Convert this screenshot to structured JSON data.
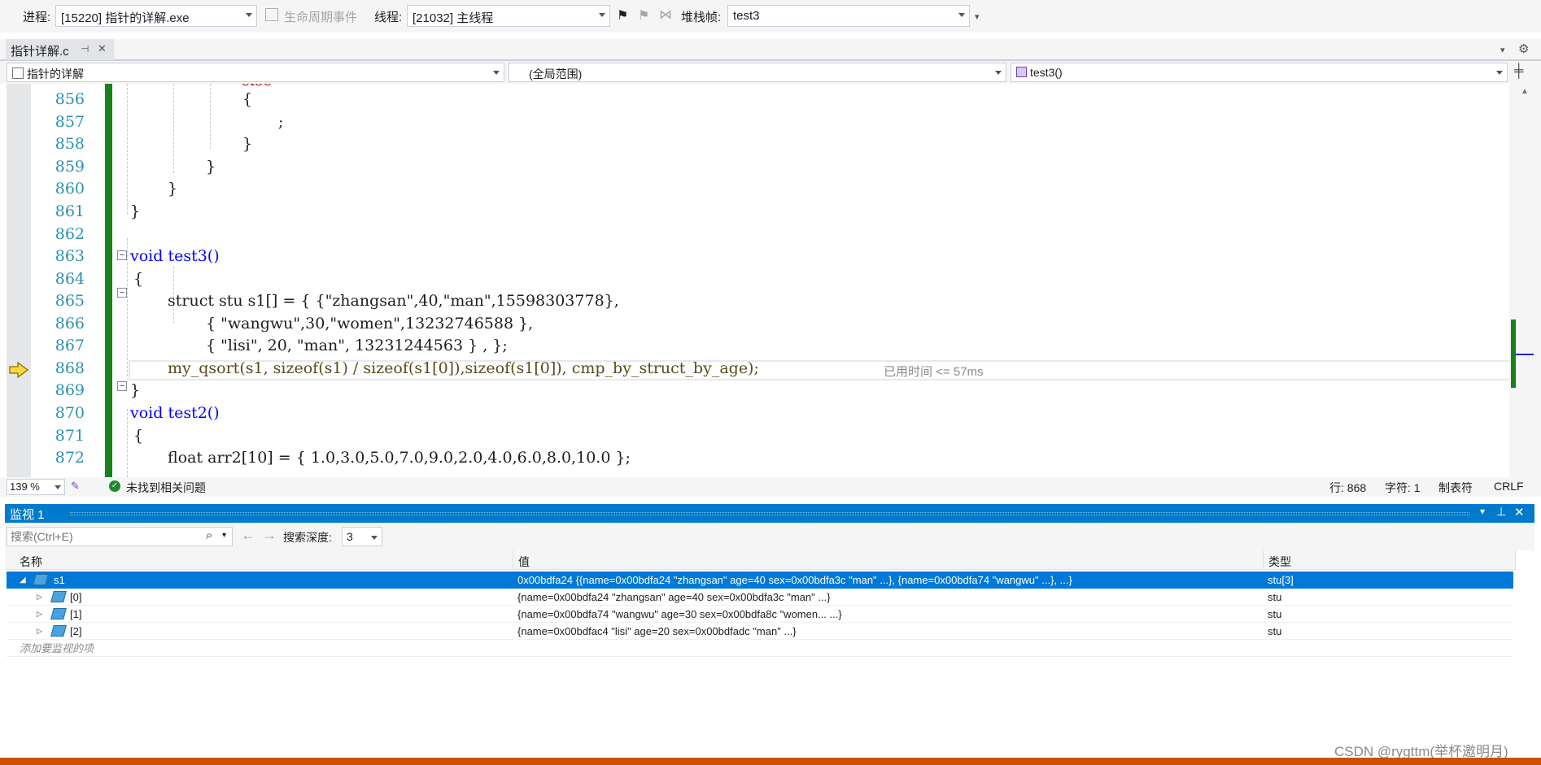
{
  "toolbar": {
    "process_label": "进程:",
    "process_value": "[15220] 指针的详解.exe",
    "lifecycle_label": "生命周期事件",
    "thread_label": "线程:",
    "thread_value": "[21032] 主线程",
    "stackframe_label": "堆栈帧:",
    "stackframe_value": "test3"
  },
  "tab": {
    "title": "指针详解.c",
    "pin": "⊣",
    "close": "✕"
  },
  "navbar": {
    "project": "指针的详解",
    "scope": "(全局范围)",
    "function": "test3()"
  },
  "editor": {
    "lines": [
      {
        "n": "856",
        "text": "{"
      },
      {
        "n": "857",
        "text": ";"
      },
      {
        "n": "858",
        "text": "}"
      },
      {
        "n": "859",
        "text": "}"
      },
      {
        "n": "860",
        "text": "}"
      },
      {
        "n": "861",
        "text": "}"
      },
      {
        "n": "862",
        "text": ""
      },
      {
        "n": "863",
        "text": "void test3()"
      },
      {
        "n": "864",
        "text": "{"
      },
      {
        "n": "865",
        "text": "struct stu s1[] = { {\"zhangsan\",40,\"man\",15598303778},"
      },
      {
        "n": "866",
        "text": "{ \"wangwu\",30,\"women\",13232746588 },"
      },
      {
        "n": "867",
        "text": "{ \"lisi\", 20, \"man\", 13231244563 } , };"
      },
      {
        "n": "868",
        "text": "my_qsort(s1, sizeof(s1) / sizeof(s1[0]),sizeof(s1[0]), cmp_by_struct_by_age);"
      },
      {
        "n": "869",
        "text": "}"
      },
      {
        "n": "870",
        "text": "void test2()"
      },
      {
        "n": "871",
        "text": "{"
      },
      {
        "n": "872",
        "text": "float arr2[10] = { 1.0,3.0,5.0,7.0,9.0,2.0,4.0,6.0,8.0,10.0 };"
      }
    ],
    "elapsed_hint": "已用时间 <= 57ms"
  },
  "status": {
    "zoom": "139 %",
    "issues": "未找到相关问题",
    "line": "行: 868",
    "char": "字符: 1",
    "tabs": "制表符",
    "eol": "CRLF"
  },
  "watch": {
    "title": "监视 1",
    "search_placeholder": "搜索(Ctrl+E)",
    "depth_label": "搜索深度:",
    "depth_value": "3",
    "columns": [
      "名称",
      "值",
      "类型"
    ],
    "rows": [
      {
        "name": "s1",
        "value": "0x00bdfa24 {{name=0x00bdfa24 \"zhangsan\" age=40 sex=0x00bdfa3c \"man\" ...}, {name=0x00bdfa74 \"wangwu\" ...}, ...}",
        "type": "stu[3]"
      },
      {
        "name": "[0]",
        "value": "{name=0x00bdfa24 \"zhangsan\" age=40 sex=0x00bdfa3c \"man\" ...}",
        "type": "stu"
      },
      {
        "name": "[1]",
        "value": "{name=0x00bdfa74 \"wangwu\" age=30 sex=0x00bdfa8c \"women... ...}",
        "type": "stu"
      },
      {
        "name": "[2]",
        "value": "{name=0x00bdfac4 \"lisi\" age=20 sex=0x00bdfadc \"man\" ...}",
        "type": "stu"
      }
    ],
    "add_hint": "添加要监视的项"
  },
  "watermark": "CSDN @rygttm(举杯邀明月)",
  "colors": {
    "accent": "#007acc",
    "selection": "#0078d7",
    "change_bar": "#17821a",
    "keyword": "#0000ff",
    "string": "#a31515",
    "line_number": "#2b91af",
    "bottom_bar": "#ca5100"
  }
}
